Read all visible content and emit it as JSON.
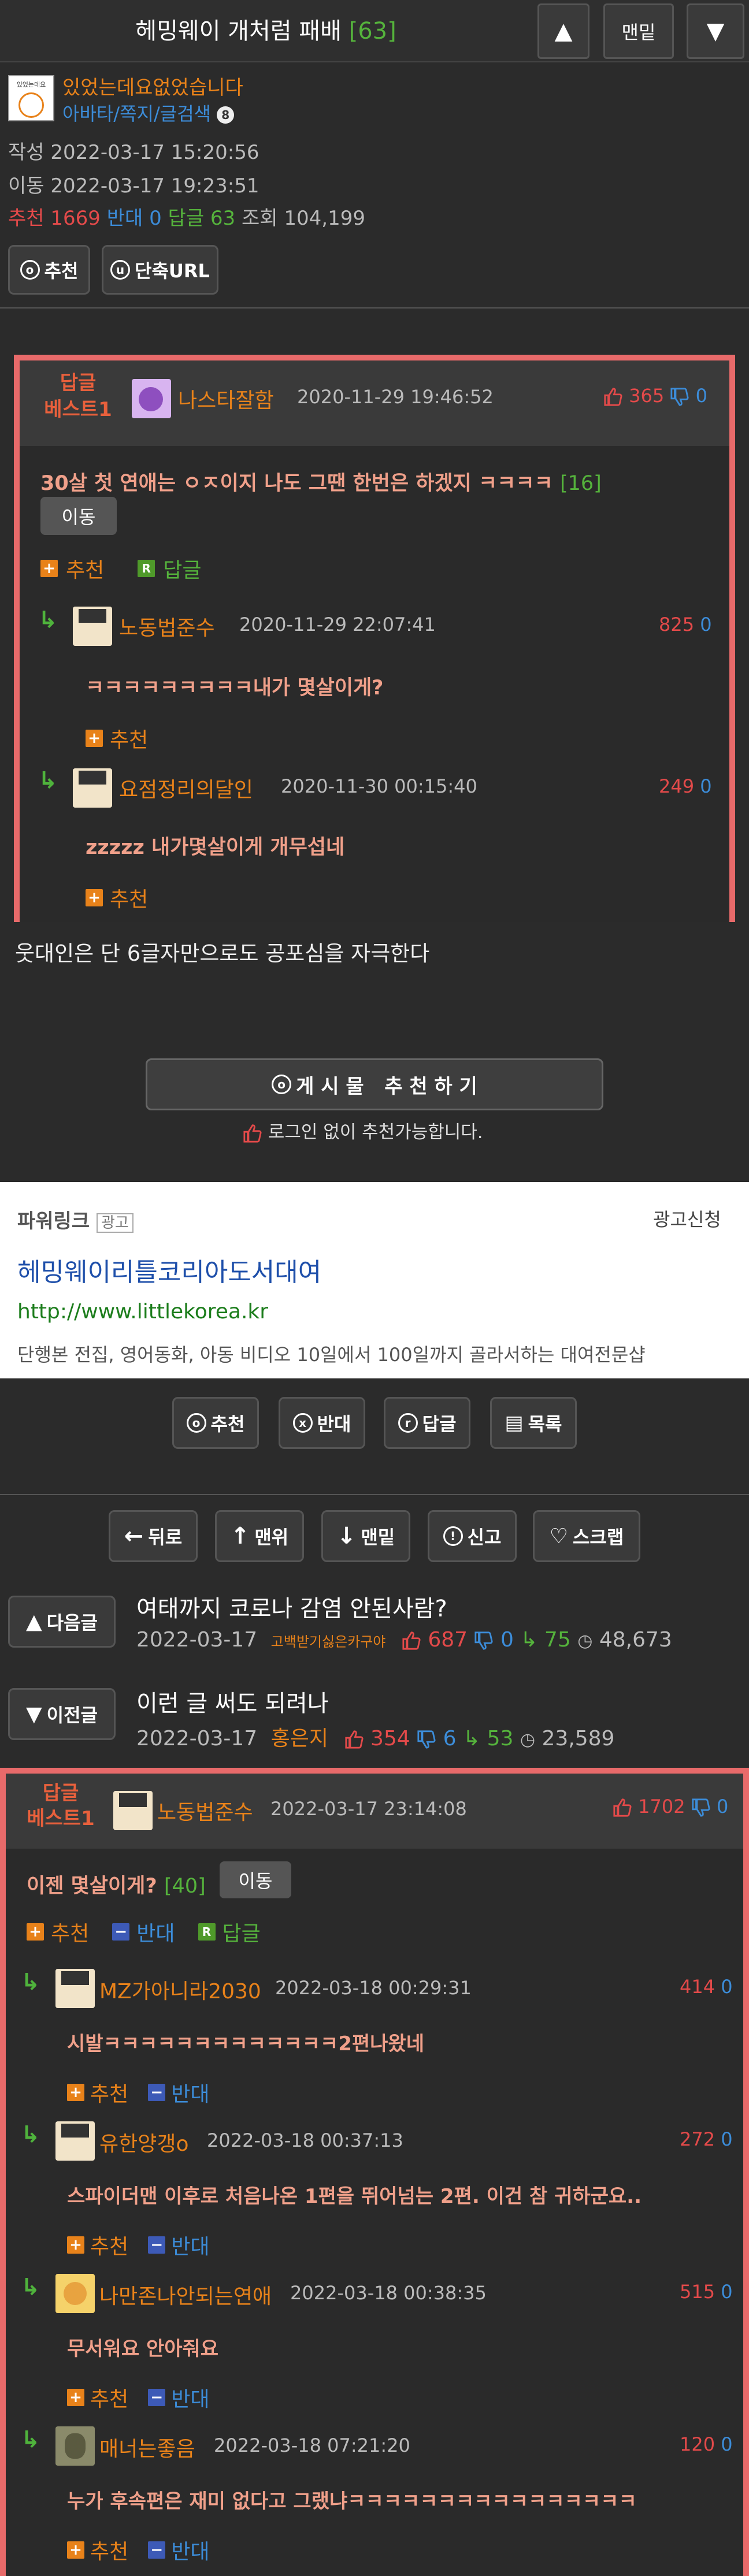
{
  "header": {
    "title": "헤밍웨이 개처럼 패배",
    "reply_count": "[63]",
    "up_label": "▲",
    "bottom_label": "맨밑",
    "down_label": "▼"
  },
  "author": {
    "logo_text": "있었는데요",
    "nick": "있었는데요없었습니다",
    "links": "아바타/쪽지/글검색",
    "badge": "8"
  },
  "meta": {
    "created": "작성 2022-03-17 15:20:56",
    "moved": "이동 2022-03-17 19:23:51",
    "rec_label": "추천",
    "rec": "1669",
    "opp_label": "반대",
    "opp": "0",
    "reply_label": "답글",
    "reply": "63",
    "view_label": "조회",
    "views": "104,199"
  },
  "actions": {
    "recommend": "추천",
    "short_url": "단축URL"
  },
  "best1": {
    "label_line1": "답글",
    "label_line2": "베스트1",
    "nick": "나스타잘함",
    "date": "2020-11-29 19:46:52",
    "up": "365",
    "down": "0",
    "text": "30살 첫 연애는 ㅇㅈ이지 나도 그땐 한번은 하겠지 ㅋㅋㅋㅋ",
    "count": "[16]",
    "move_btn": "이동",
    "rec_label": "추천",
    "reply_label": "답글",
    "replies": [
      {
        "nick": "노동법준수",
        "date": "2020-11-29 22:07:41",
        "up": "825",
        "down": "0",
        "text": "ㅋㅋㅋㅋㅋㅋㅋㅋㅋ내가 몇살이게?",
        "rec": "추천"
      },
      {
        "nick": "요점정리의달인",
        "date": "2020-11-30 00:15:40",
        "up": "249",
        "down": "0",
        "text": "zzzzz 내가몇살이게 개무섭네",
        "rec": "추천"
      }
    ]
  },
  "body_text": "웃대인은 단 6글자만으로도 공포심을 자극한다",
  "recommend_big": {
    "label": "게 시 물   추 천 하 기",
    "note": "로그인 없이 추천가능합니다."
  },
  "ad": {
    "title": "파워링크",
    "tag": "광고",
    "apply": "광고신청",
    "headline": "헤밍웨이리틀코리아도서대여",
    "url": "http://www.littlekorea.kr",
    "desc": "단행본 전집, 영어동화, 아동 비디오 10일에서 100일까지 골라서하는 대여전문샵"
  },
  "bottom_actions": {
    "rec": "추천",
    "opp": "반대",
    "reply": "답글",
    "list": "목록"
  },
  "nav_actions": {
    "back": "뒤로",
    "top": "맨위",
    "bottom": "맨밑",
    "report": "신고",
    "scrap": "스크랩"
  },
  "next_post": {
    "label": "다음글",
    "title": "여태까지 코로나 감염 안된사람?",
    "date": "2022-03-17",
    "author": "고백받기싫은카구야",
    "up": "687",
    "down": "0",
    "reply": "75",
    "views": "48,673"
  },
  "prev_post": {
    "label": "이전글",
    "title": "이런 글 써도 되려나",
    "date": "2022-03-17",
    "author": "홍은지",
    "up": "354",
    "down": "6",
    "reply": "53",
    "views": "23,589"
  },
  "best2": {
    "label_line1": "답글",
    "label_line2": "베스트1",
    "nick": "노동법준수",
    "date": "2022-03-17 23:14:08",
    "up": "1702",
    "down": "0",
    "text": "이젠 몇살이게?",
    "count": "[40]",
    "move_btn": "이동",
    "rec_label": "추천",
    "opp_label": "반대",
    "reply_label": "답글",
    "replies": [
      {
        "nick": "MZ가아니라2030",
        "date": "2022-03-18 00:29:31",
        "up": "414",
        "down": "0",
        "text": "시발ㅋㅋㅋㅋㅋㅋㅋㅋㅋㅋㅋㅋㅋ2편나왔네",
        "rec": "추천",
        "opp": "반대"
      },
      {
        "nick": "유한양갱o",
        "date": "2022-03-18 00:37:13",
        "up": "272",
        "down": "0",
        "text": "스파이더맨 이후로 처음나온 1편을 뛰어넘는 2편. 이건 참 귀하군요..",
        "rec": "추천",
        "opp": "반대"
      },
      {
        "nick": "나만존나안되는연애",
        "date": "2022-03-18 00:38:35",
        "up": "515",
        "down": "0",
        "text": "무서워요 안아줘요",
        "rec": "추천",
        "opp": "반대"
      },
      {
        "nick": "매너는좋음",
        "date": "2022-03-18 07:21:20",
        "up": "120",
        "down": "0",
        "text": "누가 후속편은 재미 없다고 그랬냐ㅋㅋㅋㅋㅋㅋㅋㅋㅋㅋㅋㅋㅋㅋㅋㅋ",
        "rec": "추천",
        "opp": "반대"
      }
    ]
  }
}
